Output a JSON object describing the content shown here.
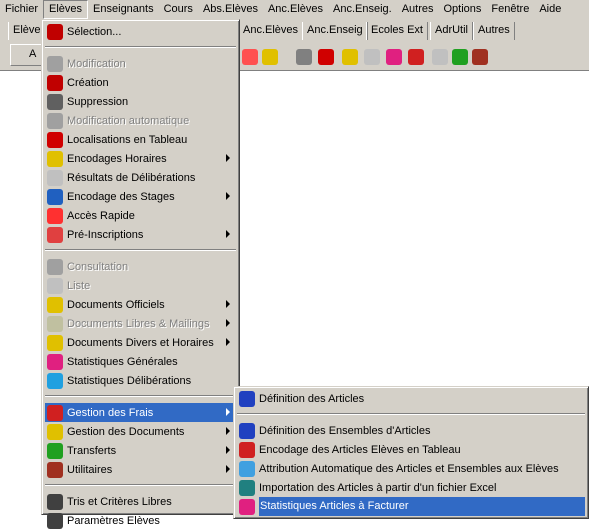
{
  "menubar": [
    "Fichier",
    "Elèves",
    "Enseignants",
    "Cours",
    "Abs.Elèves",
    "Anc.Elèves",
    "Anc.Enseig.",
    "Autres",
    "Options",
    "Fenêtre",
    "Aide"
  ],
  "tabs": [
    "Elève",
    "Anc.Elèves",
    "Anc.Enseig",
    "Ecoles Ext",
    "AdrUtil",
    "Autres"
  ],
  "toolbar_first_label": "A",
  "eleves_menu": [
    {
      "label": "Sélection...",
      "icon": "eraser-icon",
      "color": "#c00000"
    },
    {
      "sep": true
    },
    {
      "label": "Modification",
      "icon": "edit-icon",
      "disabled": true,
      "color": "#a0a0a0"
    },
    {
      "label": "Création",
      "icon": "new-icon",
      "color": "#c00000"
    },
    {
      "label": "Suppression",
      "icon": "delete-icon",
      "color": "#606060"
    },
    {
      "label": "Modification automatique",
      "icon": "car-icon",
      "disabled": true,
      "color": "#a0a0a0"
    },
    {
      "label": "Localisations en Tableau",
      "icon": "grid-icon",
      "color": "#d00000"
    },
    {
      "label": "Encodages Horaires",
      "icon": "schedule-icon",
      "sub": true,
      "color": "#e0c000"
    },
    {
      "label": "Résultats de Délibérations",
      "icon": "book-icon",
      "color": "#c0c0c0"
    },
    {
      "label": "Encodage des Stages",
      "icon": "stages-icon",
      "sub": true,
      "color": "#2060c0"
    },
    {
      "label": "Accès Rapide",
      "icon": "rabbit-icon",
      "color": "#ff3030"
    },
    {
      "label": "Pré-Inscriptions",
      "icon": "clock-icon",
      "sub": true,
      "color": "#e04040"
    },
    {
      "sep": true
    },
    {
      "label": "Consultation",
      "icon": "view-icon",
      "disabled": true,
      "color": "#a0a0a0"
    },
    {
      "label": "Liste",
      "icon": "list-icon",
      "disabled": true,
      "color": "#c0c0c0"
    },
    {
      "label": "Documents Officiels",
      "icon": "documents-icon",
      "sub": true,
      "color": "#e0c000"
    },
    {
      "label": "Documents Libres  & Mailings",
      "icon": "documents-icon",
      "sub": true,
      "disabled": true,
      "color": "#c0c0a0"
    },
    {
      "label": "Documents Divers et Horaires",
      "icon": "schedule-icon",
      "sub": true,
      "color": "#e0c000"
    },
    {
      "label": "Statistiques Générales",
      "icon": "chart-icon",
      "color": "#e02080"
    },
    {
      "label": "Statistiques Délibérations",
      "icon": "chart-icon",
      "color": "#20a0e0"
    },
    {
      "sep": true
    },
    {
      "label": "Gestion des Frais",
      "icon": "money-bag-icon",
      "sub": true,
      "selected": true,
      "color": "#d02020"
    },
    {
      "label": "Gestion des Documents",
      "icon": "documents-icon",
      "sub": true,
      "color": "#e0c000"
    },
    {
      "label": "Transferts",
      "icon": "transfer-icon",
      "sub": true,
      "color": "#20a020"
    },
    {
      "label": "Utilitaires",
      "icon": "tools-icon",
      "sub": true,
      "color": "#a03020"
    },
    {
      "sep": true
    },
    {
      "label": "Tris et Critères Libres",
      "icon": "sort-icon",
      "color": "#404040"
    },
    {
      "label": "Paramètres Elèves",
      "icon": "settings-icon",
      "color": "#404040"
    }
  ],
  "frais_submenu": [
    {
      "label": "Définition des Articles",
      "icon": "money-bag-icon",
      "color": "#2040c0"
    },
    {
      "sep": true
    },
    {
      "label": "Définition des Ensembles d'Articles",
      "icon": "money-bag-icon",
      "color": "#2040c0"
    },
    {
      "label": "Encodage des Articles Elèves en Tableau",
      "icon": "money-bag-icon",
      "color": "#d02020"
    },
    {
      "label": "Attribution Automatique des Articles et Ensembles aux Elèves",
      "icon": "money-bag-icon",
      "color": "#40a0e0"
    },
    {
      "label": "Importation des Articles à partir d'un fichier Excel",
      "icon": "excel-icon",
      "color": "#208080"
    },
    {
      "label": "Statistiques Articles à Facturer",
      "icon": "chart-icon",
      "selected": true,
      "color": "#e02080"
    }
  ],
  "colors": {
    "highlight": "#316ac5",
    "chrome": "#d4d0c8"
  }
}
